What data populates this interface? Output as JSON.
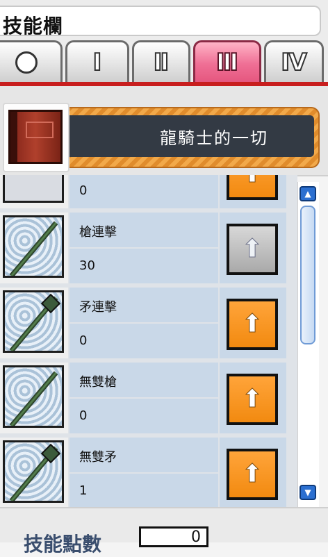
{
  "window": {
    "title": "技能欄"
  },
  "tabs": [
    {
      "label": "○",
      "active": false
    },
    {
      "label": "Ⅰ",
      "active": false
    },
    {
      "label": "Ⅱ",
      "active": false
    },
    {
      "label": "Ⅲ",
      "active": true
    },
    {
      "label": "Ⅳ",
      "active": false
    }
  ],
  "job": {
    "name": "龍騎士的一切",
    "icon": "red-book-icon"
  },
  "skills": [
    {
      "name": "",
      "level": "0",
      "icon": "partial-skill-icon",
      "can_level_up": true
    },
    {
      "name": "槍連擊",
      "level": "30",
      "icon": "spear-icon",
      "can_level_up": false
    },
    {
      "name": "矛連擊",
      "level": "0",
      "icon": "polearm-icon",
      "can_level_up": true
    },
    {
      "name": "無雙槍",
      "level": "0",
      "icon": "spear-icon",
      "can_level_up": true
    },
    {
      "name": "無雙矛",
      "level": "1",
      "icon": "polearm-icon",
      "can_level_up": true
    }
  ],
  "footer": {
    "sp_label": "技能點數",
    "sp_value": "0"
  },
  "colors": {
    "active_tab": "#e5577f",
    "up_button": "#f28a10",
    "tab_underline": "#c81e1e"
  }
}
